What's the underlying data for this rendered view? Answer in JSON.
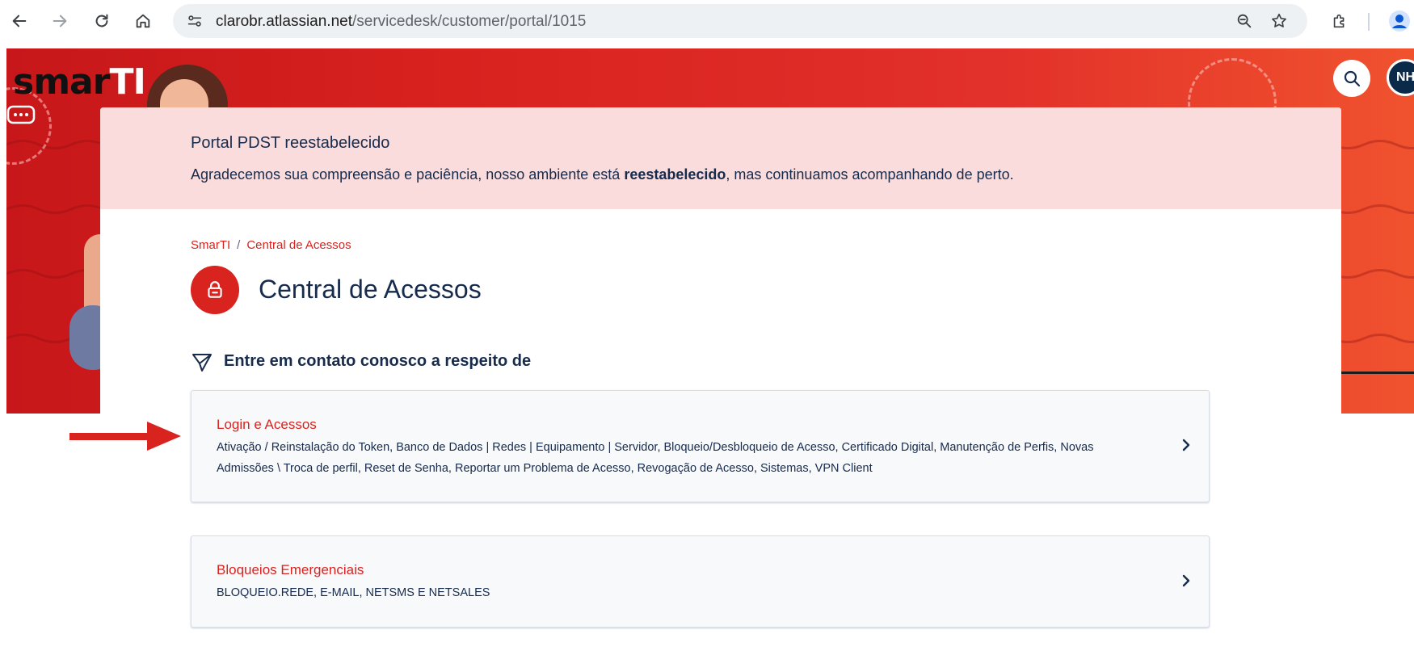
{
  "browser": {
    "url_host": "clarobr.atlassian.net",
    "url_path": "/servicedesk/customer/portal/1015"
  },
  "hero": {
    "logo_main": "smar",
    "logo_accent": "TI",
    "avatar_initials": "NH"
  },
  "banner": {
    "title": "Portal PDST reestabelecido",
    "body_before": "Agradecemos sua compreensão e paciência, nosso ambiente está ",
    "body_bold": "reestabelecido",
    "body_after": ", mas continuamos acompanhando de perto."
  },
  "breadcrumb": {
    "root": "SmarTI",
    "separator": "/",
    "current": "Central de Acessos"
  },
  "portal": {
    "title": "Central de Acessos"
  },
  "contact_heading": "Entre em contato conosco a respeito de",
  "request_types": [
    {
      "title": "Login e Acessos",
      "description": "Ativação / Reinstalação do Token, Banco de Dados | Redes | Equipamento | Servidor, Bloqueio/Desbloqueio de Acesso, Certificado Digital, Manutenção de Perfis, Novas Admissões \\ Troca de perfil, Reset de Senha, Reportar um Problema de Acesso, Revogação de Acesso, Sistemas, VPN Client"
    },
    {
      "title": "Bloqueios Emergenciais",
      "description": "BLOQUEIO.REDE, E-MAIL, NETSMS E NETSALES"
    }
  ],
  "colors": {
    "brand_red": "#d9231f",
    "banner_bg": "#fadcdc",
    "text_dark": "#172b4d"
  }
}
